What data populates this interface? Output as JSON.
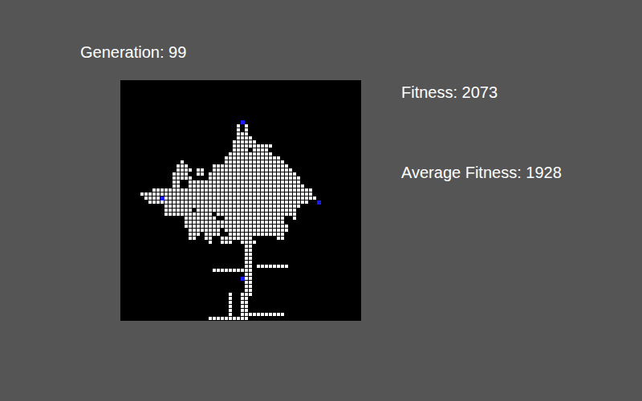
{
  "header": {
    "generation": "Generation: 99"
  },
  "stats": [
    {
      "label": "Fitness: 2073"
    },
    {
      "label": "Average Fitness: 1928"
    }
  ],
  "grid": {
    "cols": 60,
    "rows": 60,
    "cells": [
      {
        "row": 11,
        "spans": [
          [
            29,
            29
          ],
          [
            31,
            31
          ]
        ]
      },
      {
        "row": 12,
        "spans": [
          [
            29,
            29
          ],
          [
            31,
            31
          ]
        ]
      },
      {
        "row": 13,
        "spans": [
          [
            29,
            31
          ]
        ]
      },
      {
        "row": 14,
        "spans": [
          [
            29,
            32
          ]
        ]
      },
      {
        "row": 15,
        "spans": [
          [
            28,
            33
          ]
        ]
      },
      {
        "row": 16,
        "spans": [
          [
            28,
            37
          ]
        ]
      },
      {
        "row": 17,
        "spans": [
          [
            28,
            31
          ],
          [
            33,
            36
          ]
        ]
      },
      {
        "row": 18,
        "spans": [
          [
            27,
            37
          ]
        ]
      },
      {
        "row": 19,
        "spans": [
          [
            26,
            39
          ]
        ]
      },
      {
        "row": 20,
        "spans": [
          [
            15,
            15
          ],
          [
            26,
            40
          ]
        ]
      },
      {
        "row": 21,
        "spans": [
          [
            14,
            16
          ],
          [
            23,
            41
          ]
        ]
      },
      {
        "row": 22,
        "spans": [
          [
            14,
            17
          ],
          [
            19,
            20
          ],
          [
            23,
            42
          ]
        ]
      },
      {
        "row": 23,
        "spans": [
          [
            13,
            16
          ],
          [
            19,
            20
          ],
          [
            22,
            43
          ]
        ]
      },
      {
        "row": 24,
        "spans": [
          [
            13,
            17
          ],
          [
            22,
            44
          ]
        ]
      },
      {
        "row": 25,
        "spans": [
          [
            13,
            14
          ],
          [
            17,
            44
          ]
        ]
      },
      {
        "row": 26,
        "spans": [
          [
            13,
            14
          ],
          [
            17,
            45
          ]
        ]
      },
      {
        "row": 27,
        "spans": [
          [
            8,
            47
          ]
        ]
      },
      {
        "row": 28,
        "spans": [
          [
            5,
            47
          ]
        ]
      },
      {
        "row": 29,
        "spans": [
          [
            6,
            9
          ],
          [
            11,
            48
          ]
        ]
      },
      {
        "row": 30,
        "spans": [
          [
            7,
            46
          ]
        ]
      },
      {
        "row": 31,
        "spans": [
          [
            11,
            44
          ]
        ]
      },
      {
        "row": 32,
        "spans": [
          [
            11,
            17
          ],
          [
            19,
            43
          ]
        ]
      },
      {
        "row": 33,
        "spans": [
          [
            11,
            22
          ],
          [
            24,
            43
          ]
        ]
      },
      {
        "row": 34,
        "spans": [
          [
            16,
            23
          ],
          [
            26,
            40
          ],
          [
            43,
            43
          ]
        ]
      },
      {
        "row": 35,
        "spans": [
          [
            16,
            40
          ]
        ]
      },
      {
        "row": 36,
        "spans": [
          [
            16,
            41
          ]
        ]
      },
      {
        "row": 37,
        "spans": [
          [
            17,
            24
          ],
          [
            26,
            41
          ]
        ]
      },
      {
        "row": 38,
        "spans": [
          [
            17,
            19
          ],
          [
            21,
            24
          ],
          [
            27,
            40
          ]
        ]
      },
      {
        "row": 39,
        "spans": [
          [
            17,
            18
          ],
          [
            21,
            22
          ],
          [
            25,
            32
          ],
          [
            39,
            40
          ]
        ]
      },
      {
        "row": 40,
        "spans": [
          [
            22,
            22
          ],
          [
            25,
            27
          ],
          [
            30,
            33
          ]
        ]
      },
      {
        "row": 41,
        "spans": [
          [
            31,
            32
          ]
        ]
      },
      {
        "row": 42,
        "spans": [
          [
            31,
            32
          ]
        ]
      },
      {
        "row": 43,
        "spans": [
          [
            31,
            32
          ]
        ]
      },
      {
        "row": 44,
        "spans": [
          [
            31,
            32
          ]
        ]
      },
      {
        "row": 45,
        "spans": [
          [
            31,
            32
          ]
        ]
      },
      {
        "row": 46,
        "spans": [
          [
            31,
            32
          ],
          [
            34,
            41
          ]
        ]
      },
      {
        "row": 47,
        "spans": [
          [
            23,
            32
          ]
        ]
      },
      {
        "row": 48,
        "spans": [
          [
            31,
            32
          ]
        ]
      },
      {
        "row": 49,
        "spans": [
          [
            31,
            32
          ]
        ]
      },
      {
        "row": 50,
        "spans": [
          [
            31,
            32
          ]
        ]
      },
      {
        "row": 51,
        "spans": [
          [
            31,
            32
          ]
        ]
      },
      {
        "row": 52,
        "spans": [
          [
            31,
            32
          ]
        ]
      },
      {
        "row": 53,
        "spans": [
          [
            27,
            27
          ],
          [
            30,
            32
          ]
        ]
      },
      {
        "row": 54,
        "spans": [
          [
            27,
            27
          ],
          [
            30,
            31
          ]
        ]
      },
      {
        "row": 55,
        "spans": [
          [
            27,
            27
          ],
          [
            30,
            31
          ]
        ]
      },
      {
        "row": 56,
        "spans": [
          [
            27,
            27
          ],
          [
            30,
            31
          ]
        ]
      },
      {
        "row": 57,
        "spans": [
          [
            27,
            27
          ],
          [
            30,
            31
          ]
        ]
      },
      {
        "row": 58,
        "spans": [
          [
            27,
            27
          ],
          [
            30,
            40
          ]
        ]
      },
      {
        "row": 59,
        "spans": [
          [
            22,
            31
          ]
        ]
      }
    ],
    "seeds": [
      {
        "col": 30,
        "row": 10
      },
      {
        "col": 10,
        "row": 29
      },
      {
        "col": 49,
        "row": 30
      },
      {
        "col": 30,
        "row": 49
      }
    ]
  }
}
